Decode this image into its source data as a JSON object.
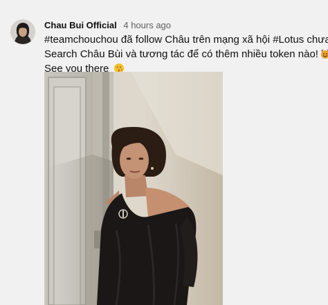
{
  "post": {
    "author": "Chau Bui Official",
    "timestamp": "4 hours ago",
    "text": {
      "hashtag_1": "#teamchouchou",
      "line1_middle": " đã follow Châu trên mạng xã hội ",
      "hashtag_2": "#Lotus",
      "line1_end": " chưa?",
      "line2": "Search Châu Bùi và tương tác để có thêm nhiều token nào!",
      "line3": "See you there"
    },
    "emojis": [
      "smiling-face-with-horns-icon",
      "face-blowing-kiss-icon"
    ],
    "image": "photo of woman with short bob haircut in black off-shoulder knit top leaning against a doorway"
  },
  "colors": {
    "background": "#f1f1f1",
    "text_primary": "#0f0f0f",
    "text_secondary": "#606060"
  }
}
